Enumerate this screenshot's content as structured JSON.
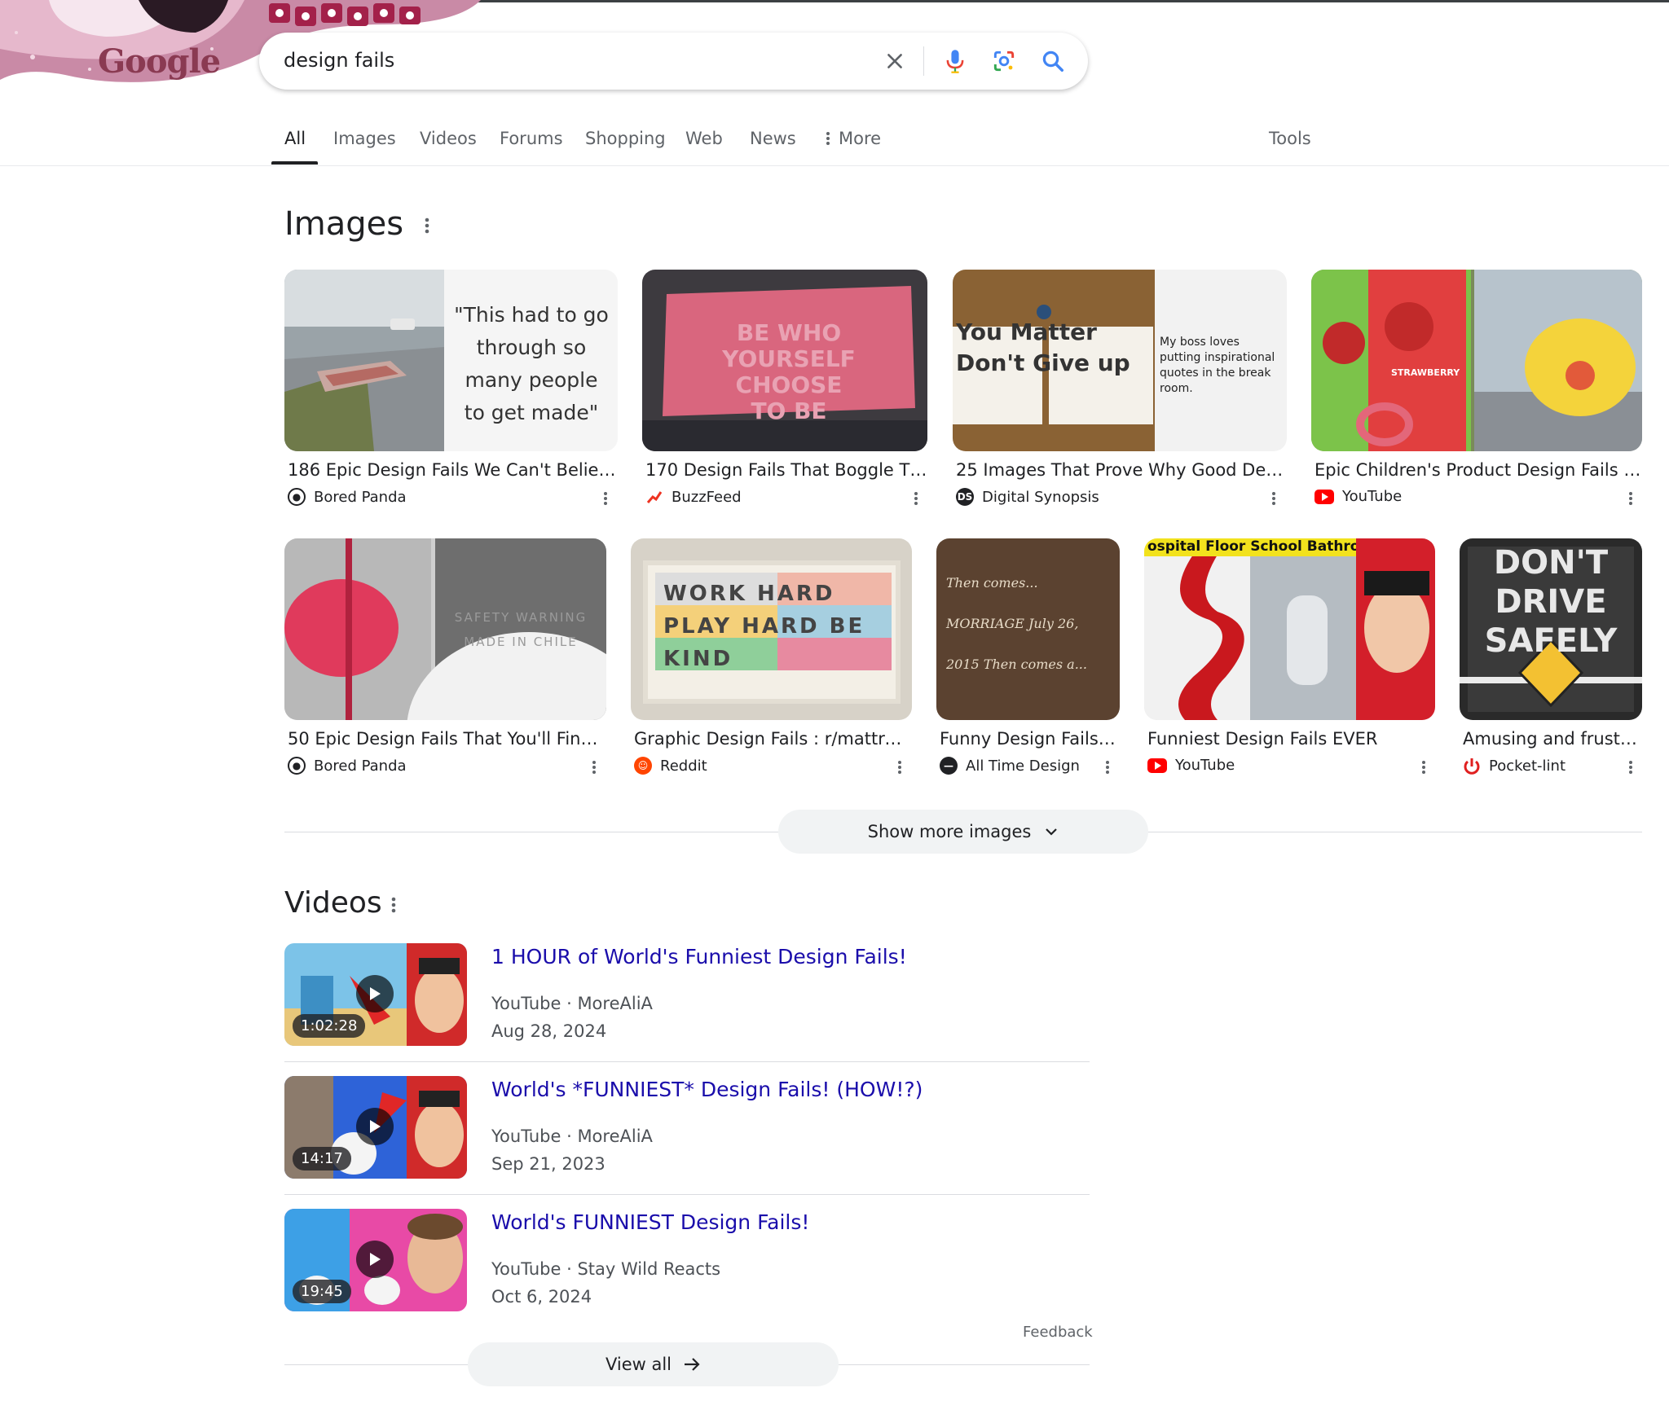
{
  "search": {
    "query": "design fails"
  },
  "logo": {
    "text": "Google"
  },
  "tabs": [
    {
      "label": "All",
      "active": true
    },
    {
      "label": "Images"
    },
    {
      "label": "Videos"
    },
    {
      "label": "Forums"
    },
    {
      "label": "Shopping"
    },
    {
      "label": "Web"
    },
    {
      "label": "News"
    },
    {
      "label": "More"
    }
  ],
  "tools_label": "Tools",
  "images_section": {
    "title": "Images",
    "cards": [
      {
        "title": "186 Epic Design Fails We Can't Believe...",
        "source": "Bored Panda",
        "thumb_text": "\"This had to go through so many people to get made\""
      },
      {
        "title": "170 Design Fails That Boggle The...",
        "source": "BuzzFeed",
        "thumb_text": "BE WHO YOURSELF CHOOSE TO BE"
      },
      {
        "title": "25 Images That Prove Why Good Desig...",
        "source": "Digital Synopsis",
        "thumb_text": "You Matter Don't Give up",
        "thumb_caption": "My boss loves putting inspirational quotes in the break room."
      },
      {
        "title": "Epic Children's Product Design Fails Th...",
        "source": "YouTube",
        "thumb_text": "STRAWBERRY"
      },
      {
        "title": "50 Epic Design Fails That You'll Find ...",
        "source": "Bored Panda",
        "thumb_text": "SAFETY WARNING MADE IN CHILE"
      },
      {
        "title": "Graphic Design Fails : r/mattrose",
        "source": "Reddit",
        "thumb_text": "WORK HARD PLAY HARD BE KIND"
      },
      {
        "title": "Funny Design Fails | ...",
        "source": "All Time Design",
        "thumb_text": "Then comes... MORRIAGE July 26, 2015 Then comes a..."
      },
      {
        "title": "Funniest Design Fails EVER",
        "source": "YouTube",
        "thumb_text": "ospital Floor School Bathroom"
      },
      {
        "title": "Amusing and frustra...",
        "source": "Pocket-lint",
        "thumb_text": "DON'T DRIVE SAFELY"
      }
    ],
    "show_more_label": "Show more images"
  },
  "videos_section": {
    "title": "Videos",
    "items": [
      {
        "title": "1 HOUR of World's Funniest Design Fails!",
        "platform": "YouTube",
        "channel": "MoreAliA",
        "date": "Aug 28, 2024",
        "duration": "1:02:28"
      },
      {
        "title": "World's *FUNNIEST* Design Fails! (HOW!?)",
        "platform": "YouTube",
        "channel": "MoreAliA",
        "date": "Sep 21, 2023",
        "duration": "14:17"
      },
      {
        "title": "World's FUNNIEST Design Fails!",
        "platform": "YouTube",
        "channel": "Stay Wild Reacts",
        "date": "Oct 6, 2024",
        "duration": "19:45"
      }
    ],
    "feedback_label": "Feedback",
    "view_all_label": "View all"
  },
  "colors": {
    "link": "#1a0dab",
    "youtube_red": "#ff0000",
    "reddit_orange": "#ff4500"
  }
}
